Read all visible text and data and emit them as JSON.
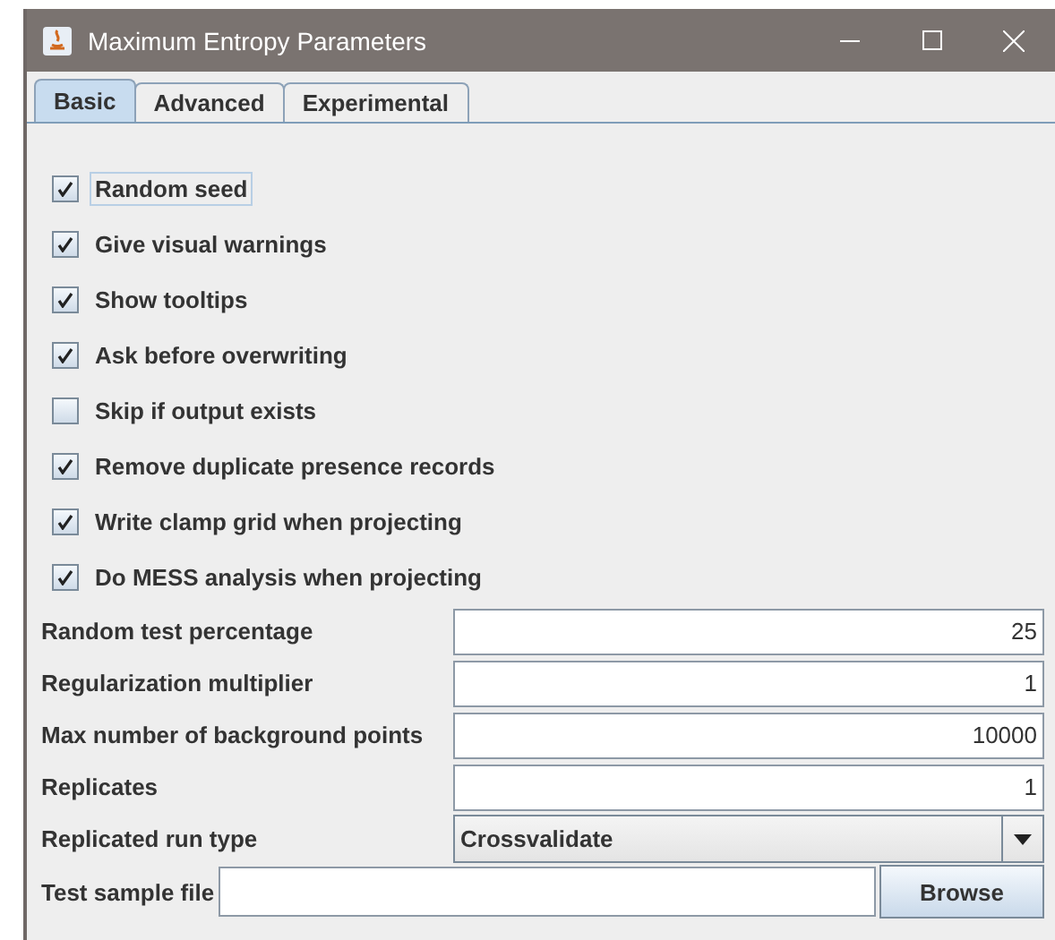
{
  "window": {
    "title": "Maximum Entropy Parameters"
  },
  "tabs": [
    {
      "label": "Basic",
      "selected": true
    },
    {
      "label": "Advanced",
      "selected": false
    },
    {
      "label": "Experimental",
      "selected": false
    }
  ],
  "checkboxes": [
    {
      "label": "Random seed",
      "checked": true,
      "focused": true
    },
    {
      "label": "Give visual warnings",
      "checked": true,
      "focused": false
    },
    {
      "label": "Show tooltips",
      "checked": true,
      "focused": false
    },
    {
      "label": "Ask before overwriting",
      "checked": true,
      "focused": false
    },
    {
      "label": "Skip if output exists",
      "checked": false,
      "focused": false
    },
    {
      "label": "Remove duplicate presence records",
      "checked": true,
      "focused": false
    },
    {
      "label": "Write clamp grid when projecting",
      "checked": true,
      "focused": false
    },
    {
      "label": "Do MESS analysis when projecting",
      "checked": true,
      "focused": false
    }
  ],
  "fields": [
    {
      "kind": "text",
      "label": "Random test percentage",
      "value": "25"
    },
    {
      "kind": "text",
      "label": "Regularization multiplier",
      "value": "1"
    },
    {
      "kind": "text",
      "label": "Max number of background points",
      "value": "10000"
    },
    {
      "kind": "text",
      "label": "Replicates",
      "value": "1"
    },
    {
      "kind": "select",
      "label": "Replicated run type",
      "value": "Crossvalidate"
    }
  ],
  "file_field": {
    "label": "Test sample file",
    "button": "Browse"
  }
}
